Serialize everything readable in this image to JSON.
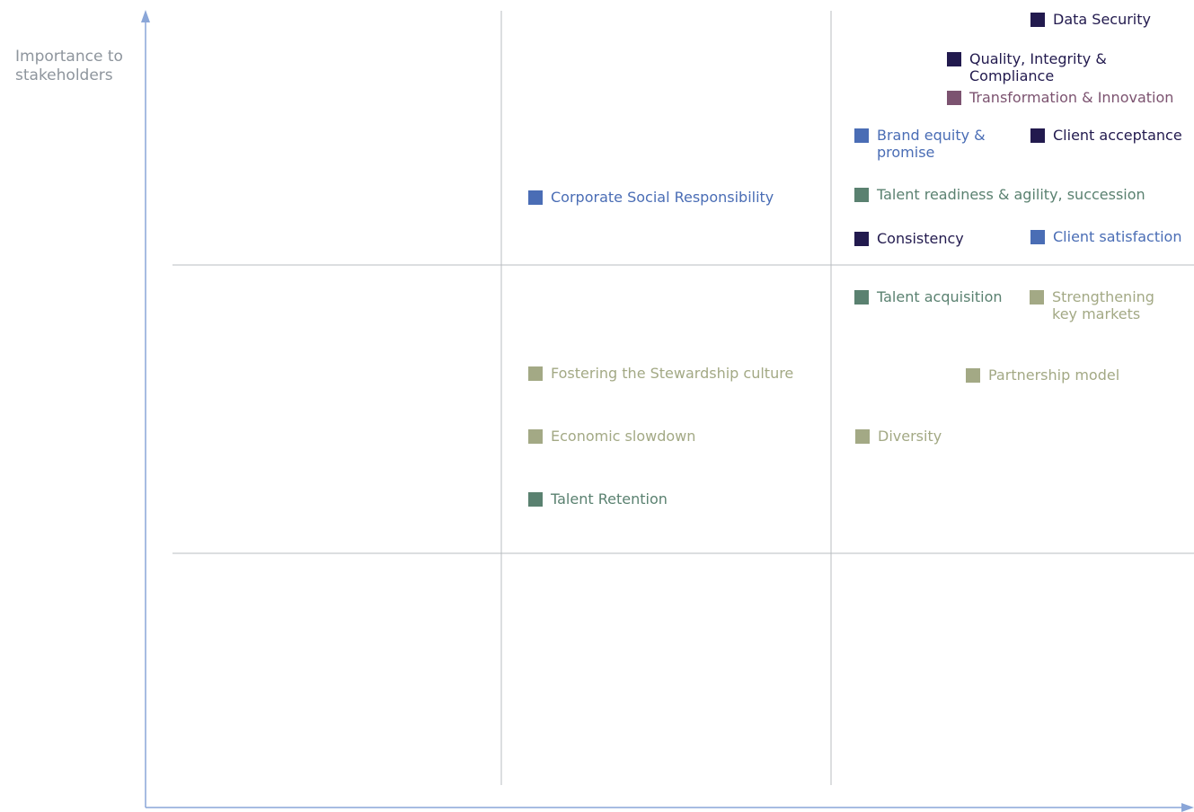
{
  "axes": {
    "y_label": "Importance to\nstakeholders",
    "axis_color": "#8aa6d8",
    "grid_color": "#b9bcc0"
  },
  "colors": {
    "navy": "#221a4e",
    "blue": "#4a6db5",
    "plum": "#7c5370",
    "teal": "#5a8170",
    "sage": "#a3a985"
  },
  "items": [
    {
      "id": "data-security",
      "label": "Data Security",
      "color": "#221a4e",
      "quadrant": "high-high"
    },
    {
      "id": "quality-integrity-compliance",
      "label": "Quality, Integrity & Compliance",
      "color": "#221a4e",
      "quadrant": "high-high"
    },
    {
      "id": "transformation-innovation",
      "label": "Transformation & Innovation",
      "color": "#7c5370",
      "quadrant": "high-high"
    },
    {
      "id": "brand-equity-promise",
      "label": "Brand equity &\npromise",
      "color": "#4a6db5",
      "quadrant": "high-high"
    },
    {
      "id": "client-acceptance",
      "label": "Client acceptance",
      "color": "#221a4e",
      "quadrant": "high-high"
    },
    {
      "id": "talent-readiness",
      "label": "Talent readiness & agility, succession",
      "color": "#5a8170",
      "quadrant": "high-high"
    },
    {
      "id": "consistency",
      "label": "Consistency",
      "color": "#221a4e",
      "quadrant": "high-high"
    },
    {
      "id": "client-satisfaction",
      "label": "Client satisfaction",
      "color": "#4a6db5",
      "quadrant": "high-high"
    },
    {
      "id": "corporate-social-responsibility",
      "label": "Corporate Social Responsibility",
      "color": "#4a6db5",
      "quadrant": "high-medium"
    },
    {
      "id": "talent-acquisition",
      "label": "Talent acquisition",
      "color": "#5a8170",
      "quadrant": "medium-high"
    },
    {
      "id": "strengthening-key-markets",
      "label": "Strengthening\nkey markets",
      "color": "#a3a985",
      "quadrant": "medium-high"
    },
    {
      "id": "fostering-stewardship-culture",
      "label": "Fostering the Stewardship culture",
      "color": "#a3a985",
      "quadrant": "medium-medium"
    },
    {
      "id": "partnership-model",
      "label": "Partnership model",
      "color": "#a3a985",
      "quadrant": "medium-high"
    },
    {
      "id": "economic-slowdown",
      "label": "Economic slowdown",
      "color": "#a3a985",
      "quadrant": "medium-medium"
    },
    {
      "id": "diversity",
      "label": "Diversity",
      "color": "#a3a985",
      "quadrant": "medium-high"
    },
    {
      "id": "talent-retention",
      "label": "Talent Retention",
      "color": "#5a8170",
      "quadrant": "medium-medium"
    }
  ]
}
